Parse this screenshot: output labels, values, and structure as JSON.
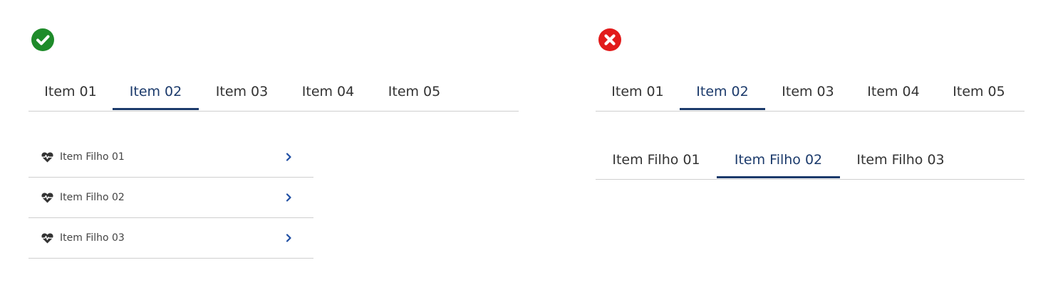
{
  "colors": {
    "accent": "#1b3a6b",
    "chevron": "#1f4ea3",
    "correct": "#1e8b2a",
    "incorrect": "#e21b1b",
    "divider": "#cfcfcf"
  },
  "correct_example": {
    "status_icon": "check-circle-icon",
    "tabs": [
      {
        "label": "Item 01",
        "active": false
      },
      {
        "label": "Item 02",
        "active": true
      },
      {
        "label": "Item 03",
        "active": false
      },
      {
        "label": "Item 04",
        "active": false
      },
      {
        "label": "Item 05",
        "active": false
      }
    ],
    "children": [
      {
        "icon": "heartbeat-icon",
        "label": "Item Filho 01",
        "action_icon": "chevron-right-icon"
      },
      {
        "icon": "heartbeat-icon",
        "label": "Item Filho 02",
        "action_icon": "chevron-right-icon"
      },
      {
        "icon": "heartbeat-icon",
        "label": "Item Filho 03",
        "action_icon": "chevron-right-icon"
      }
    ]
  },
  "incorrect_example": {
    "status_icon": "x-circle-icon",
    "tabs": [
      {
        "label": "Item 01",
        "active": false
      },
      {
        "label": "Item 02",
        "active": true
      },
      {
        "label": "Item 03",
        "active": false
      },
      {
        "label": "Item 04",
        "active": false
      },
      {
        "label": "Item 05",
        "active": false
      }
    ],
    "subtabs": [
      {
        "label": "Item Filho 01",
        "active": false
      },
      {
        "label": "Item Filho 02",
        "active": true
      },
      {
        "label": "Item Filho 03",
        "active": false
      }
    ]
  }
}
